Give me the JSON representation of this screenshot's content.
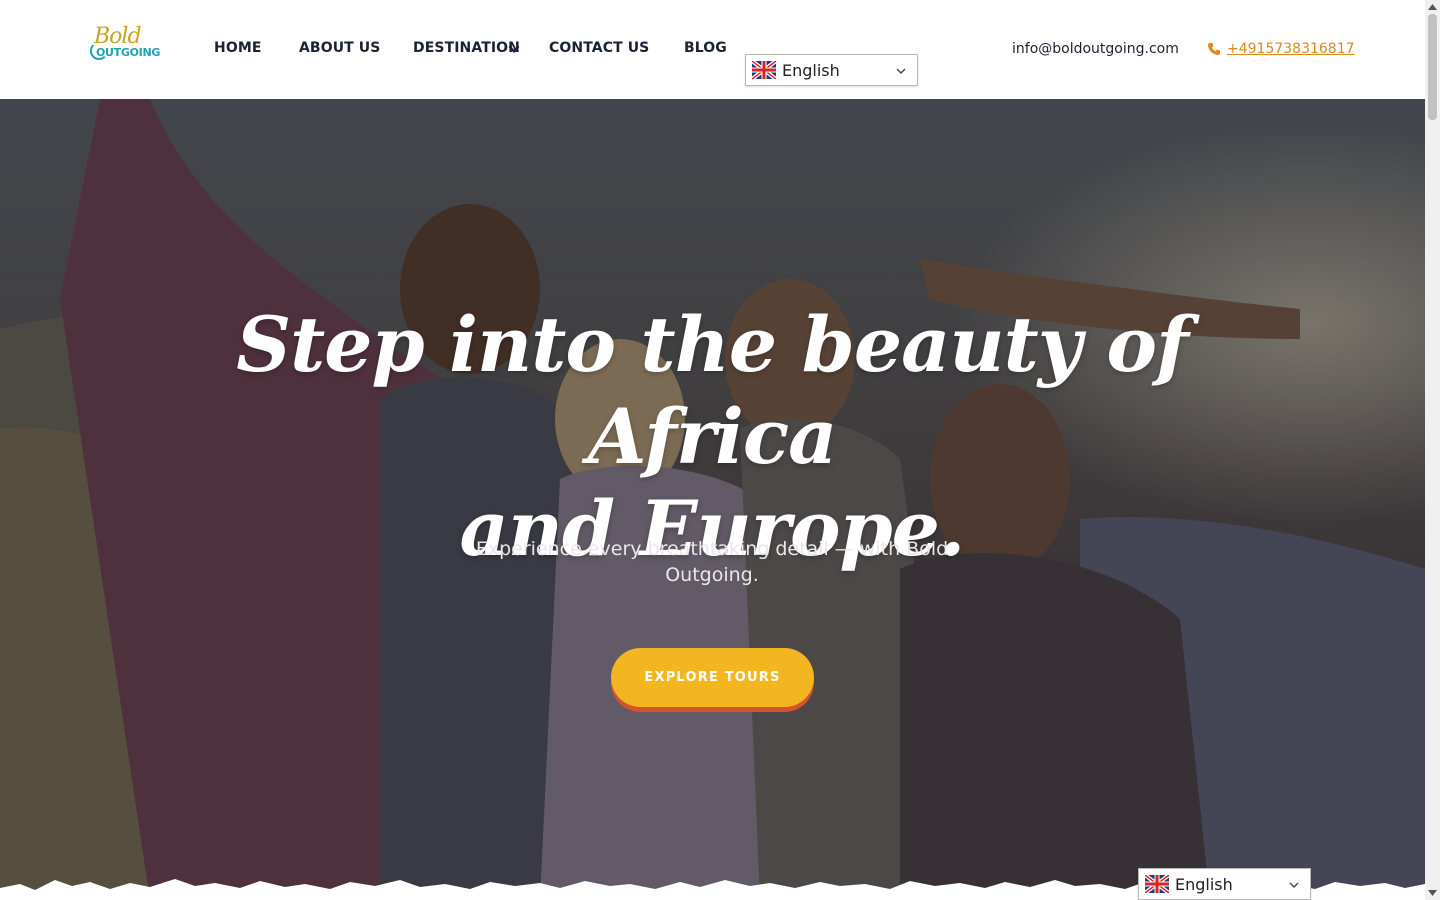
{
  "brand": {
    "logo_top": "Bold",
    "logo_bottom": "OUTGOING"
  },
  "nav": {
    "items": [
      {
        "label": "HOME"
      },
      {
        "label": "ABOUT US"
      },
      {
        "label": "DESTINATION"
      },
      {
        "label": "CONTACT US"
      },
      {
        "label": "BLOG"
      }
    ]
  },
  "language": {
    "selected": "English",
    "flag": "uk-flag-icon"
  },
  "contact": {
    "email": "info@boldoutgoing.com",
    "phone": "+4915738316817"
  },
  "hero": {
    "title_line1": "Step into the beauty of Africa",
    "title_line2": "and Europe.",
    "subtitle": "Experience every breathtaking detail — with Bold Outgoing.",
    "cta_label": "EXPLORE TOURS"
  },
  "colors": {
    "accent": "#f3b620",
    "accent_shadow": "#d8522b",
    "phone_link": "#d98a1a",
    "nav_text": "#1a2233"
  }
}
